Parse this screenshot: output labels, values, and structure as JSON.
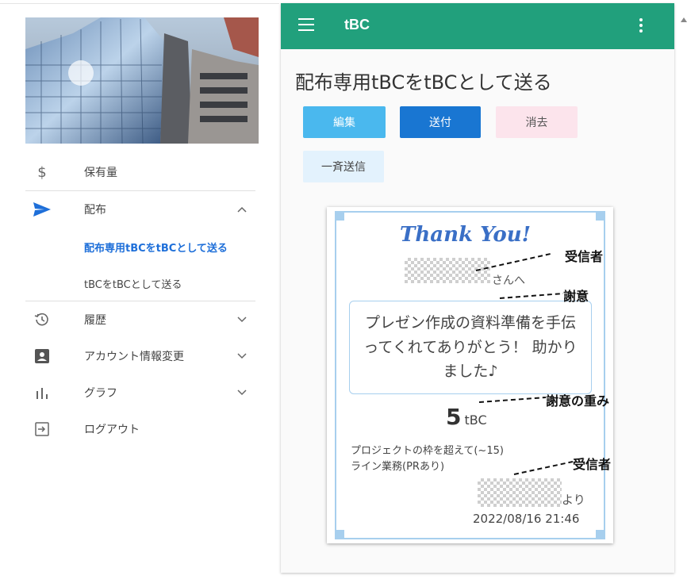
{
  "app": {
    "title": "tBC"
  },
  "nav": {
    "items": [
      {
        "label": "保有量"
      },
      {
        "label": "配布"
      },
      {
        "label": "履歴"
      },
      {
        "label": "アカウント情報変更"
      },
      {
        "label": "グラフ"
      },
      {
        "label": "ログアウト"
      }
    ],
    "sub_items": [
      {
        "label": "配布専用tBCをtBCとして送る",
        "active": true
      },
      {
        "label": "tBCをtBCとして送る",
        "active": false
      }
    ]
  },
  "page": {
    "title": "配布専用tBCをtBCとして送る",
    "buttons": {
      "edit": "編集",
      "send": "送付",
      "delete": "消去",
      "bulk_send": "一斉送信"
    }
  },
  "card": {
    "heading": "Thank You!",
    "recipient_suffix": "さんへ",
    "message": "プレゼン作成の資料準備を手伝ってくれてありがとう！ 助かりました♪",
    "amount": "5",
    "unit": "tBC",
    "category_line1": "プロジェクトの枠を超えて(~15)",
    "category_line2": "ライン業務(PRあり)",
    "sender_suffix": "より",
    "datetime": "2022/08/16 21:46"
  },
  "annotations": {
    "recipient": "受信者",
    "gratitude": "謝意",
    "gratitude_weight": "謝意の重み",
    "sender": "受信者"
  },
  "colors": {
    "appbar": "#21a07c",
    "edit": "#4ab8ee",
    "send": "#1976d2",
    "delete": "#fce4ec",
    "bulk": "#e3f2fd",
    "active_nav": "#1e6fd9",
    "card_frame": "#a7cfee"
  },
  "icons": {
    "holdings": "dollar-icon",
    "distribute": "send-icon",
    "history": "history-icon",
    "account": "account-box-icon",
    "graph": "bar-chart-icon",
    "logout": "logout-icon"
  }
}
